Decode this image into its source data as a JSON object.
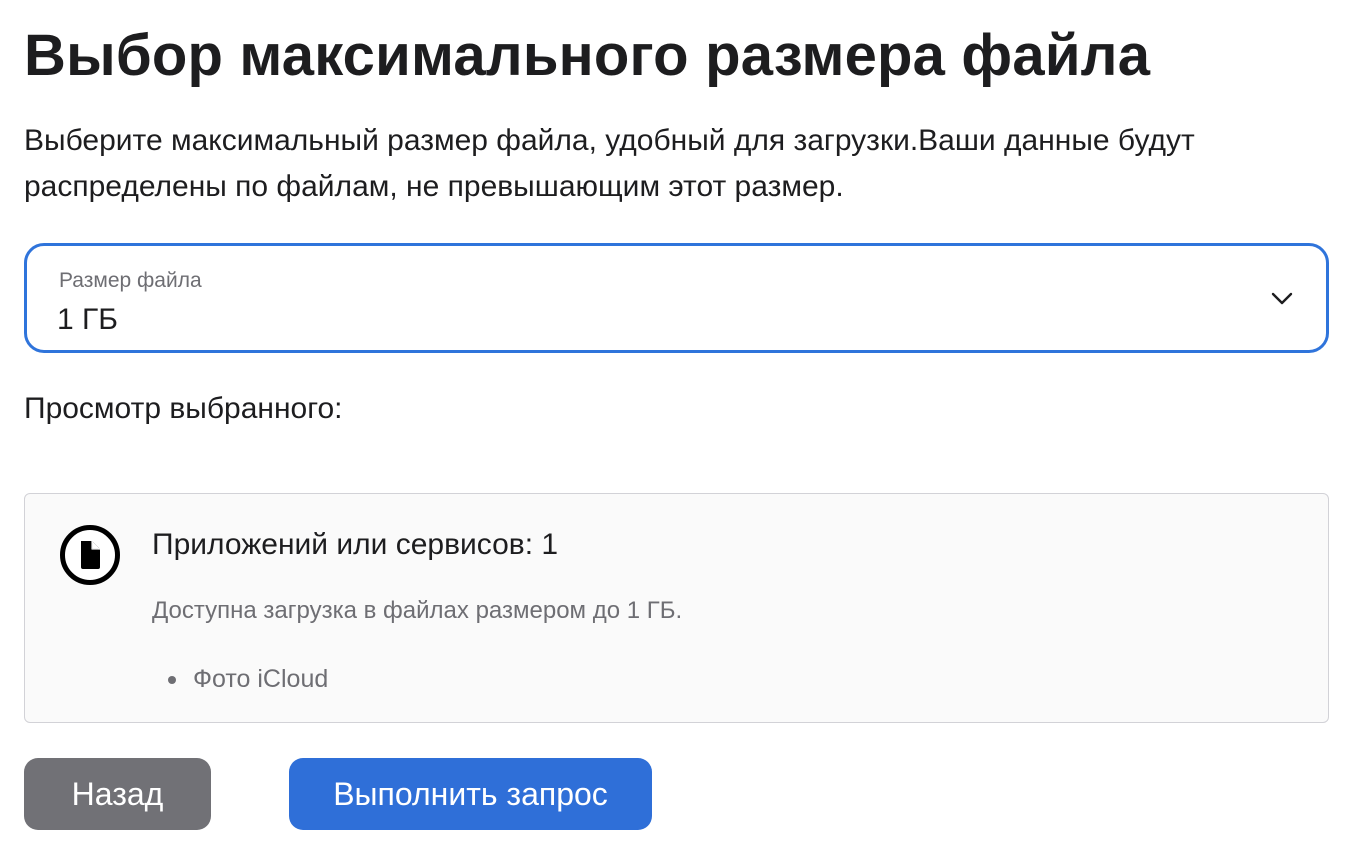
{
  "page": {
    "title": "Выбор максимального размера файла",
    "description": "Выберите максимальный размер файла, удобный для загрузки.Ваши данные будут распределены по файлам, не превышающим этот размер."
  },
  "file_size_select": {
    "label": "Размер файла",
    "value": "1 ГБ",
    "icon": "chevron-down-icon"
  },
  "preview": {
    "heading": "Просмотр выбранного:",
    "card": {
      "icon": "document-icon",
      "title": "Приложений или сервисов: 1",
      "subtitle": "Доступна загрузка в файлах размером до 1 ГБ.",
      "items": [
        "Фото iCloud"
      ]
    }
  },
  "actions": {
    "back_label": "Назад",
    "submit_label": "Выполнить запрос"
  },
  "colors": {
    "accent": "#2f74db",
    "submit_button": "#2f6fd8",
    "back_button": "#717176",
    "card_background": "#fafafa",
    "secondary_text": "#6e6e73"
  }
}
